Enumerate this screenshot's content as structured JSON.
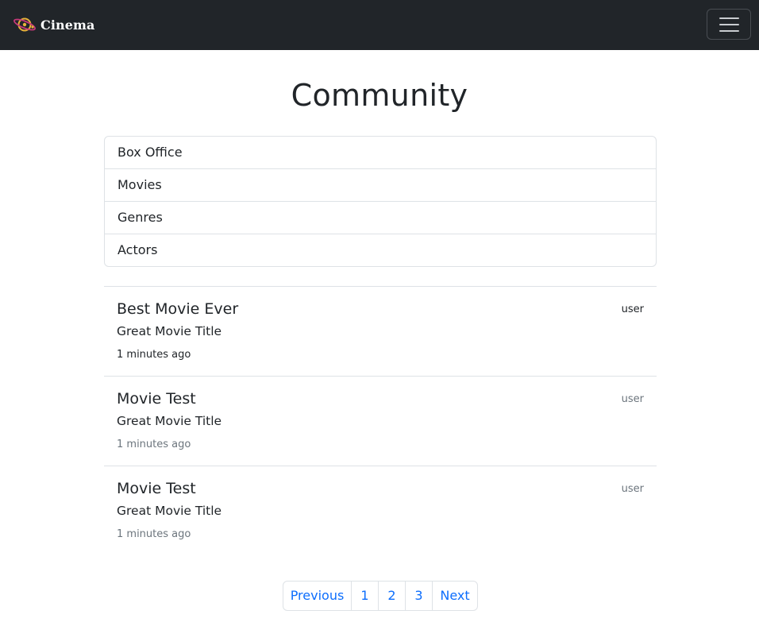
{
  "navbar": {
    "brand_name": "Cinema",
    "logo_icon": "planet-logo-icon",
    "menu_icon": "hamburger-menu-icon"
  },
  "page": {
    "title": "Community"
  },
  "categories": [
    {
      "label": "Box Office"
    },
    {
      "label": "Movies"
    },
    {
      "label": "Genres"
    },
    {
      "label": "Actors"
    }
  ],
  "posts": [
    {
      "title": "Best Movie Ever",
      "movie": "Great Movie Title",
      "time": "1 minutes ago",
      "author": "user"
    },
    {
      "title": "Movie Test",
      "movie": "Great Movie Title",
      "time": "1 minutes ago",
      "author": "user"
    },
    {
      "title": "Movie Test",
      "movie": "Great Movie Title",
      "time": "1 minutes ago",
      "author": "user"
    }
  ],
  "pagination": {
    "previous": "Previous",
    "pages": [
      "1",
      "2",
      "3"
    ],
    "next": "Next"
  },
  "colors": {
    "navbar_bg": "#212529",
    "link": "#0d6efd",
    "border": "#dee2e6",
    "muted_text": "#6c757d",
    "logo_primary": "#e8b23a",
    "logo_secondary": "#c7397a"
  }
}
